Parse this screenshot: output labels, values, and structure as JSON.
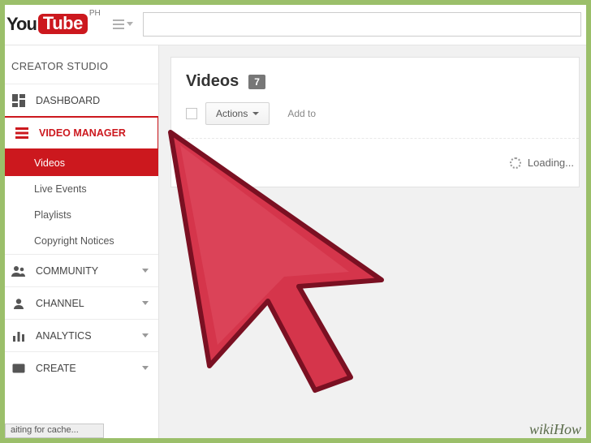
{
  "header": {
    "logo_text1": "You",
    "logo_text2": "Tube",
    "locale_sup": "PH",
    "search_placeholder": ""
  },
  "sidebar": {
    "title": "CREATOR STUDIO",
    "dashboard": "DASHBOARD",
    "video_manager": "VIDEO MANAGER",
    "vm_sub": {
      "videos": "Videos",
      "live_events": "Live Events",
      "playlists": "Playlists",
      "copyright": "Copyright Notices"
    },
    "community": "COMMUNITY",
    "channel": "CHANNEL",
    "analytics": "ANALYTICS",
    "create": "CREATE"
  },
  "main": {
    "page_title": "Videos",
    "count_badge": "7",
    "actions_label": "Actions",
    "addto_label": "Add to",
    "loading": "Loading..."
  },
  "status_bar": "aiting for cache...",
  "watermark": "wikiHow"
}
